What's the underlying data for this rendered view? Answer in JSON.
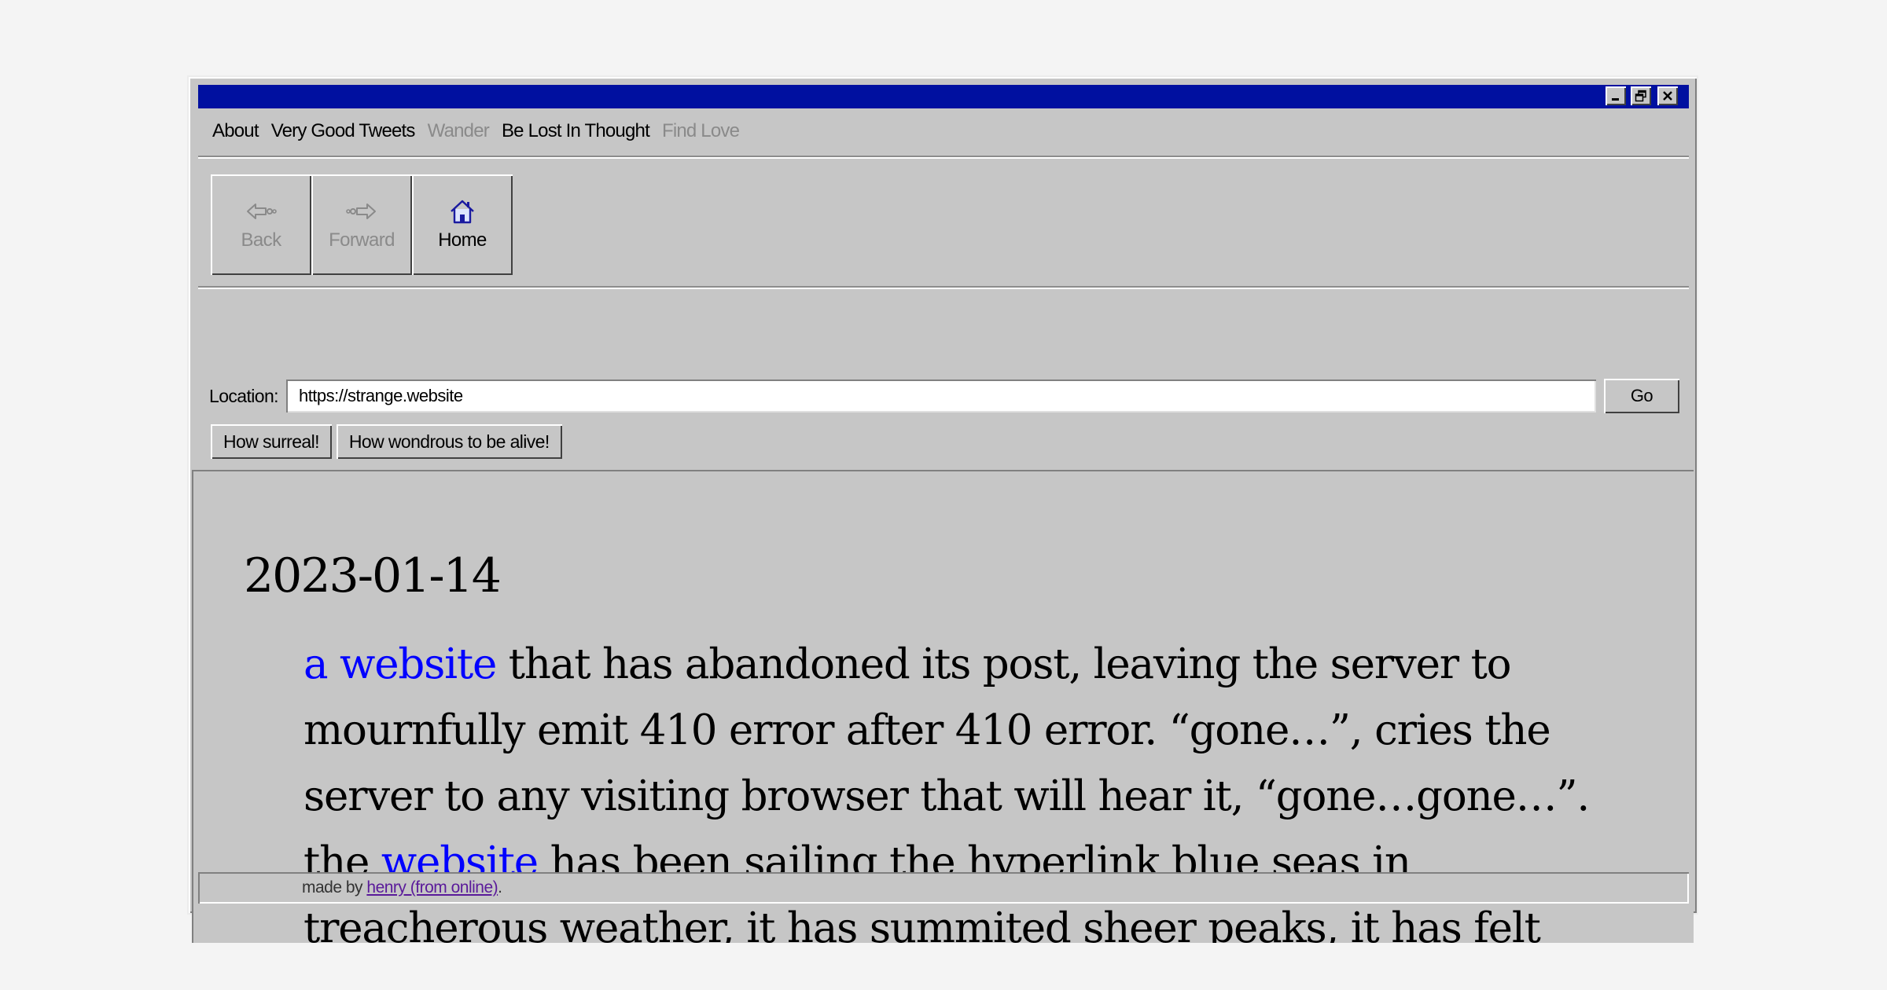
{
  "menubar": {
    "items": [
      {
        "label": "About",
        "disabled": false
      },
      {
        "label": "Very Good Tweets",
        "disabled": false
      },
      {
        "label": "Wander",
        "disabled": true
      },
      {
        "label": "Be Lost In Thought",
        "disabled": false
      },
      {
        "label": "Find Love",
        "disabled": true
      }
    ]
  },
  "window_controls": {
    "minimize_icon": "minimize-icon",
    "restore_icon": "restore-icon",
    "close_icon": "close-icon"
  },
  "toolbar": {
    "back_label": "Back",
    "forward_label": "Forward",
    "home_label": "Home",
    "back_icon": "back-arrow-icon",
    "forward_icon": "forward-arrow-icon",
    "home_icon": "home-icon"
  },
  "location": {
    "label": "Location:",
    "value": "https://strange.website",
    "go_label": "Go"
  },
  "bookmarks": [
    {
      "label": "How surreal!"
    },
    {
      "label": "How wondrous to be alive!"
    }
  ],
  "post": {
    "date": "2023-01-14",
    "segments": [
      {
        "text": "a website",
        "link": true
      },
      {
        "text": " that has abandoned its post, leaving the server to mournfully emit 410 error after 410 error. “gone…”, cries the server to any visiting browser that will hear it, “gone…gone…”. the ",
        "link": false
      },
      {
        "text": "website",
        "link": true
      },
      {
        "text": " has been sailing the hyperlink blue seas in treacherous weather, it has summited sheer peaks, it has felt",
        "link": false
      }
    ]
  },
  "statusbar": {
    "prefix": "made by ",
    "link_text": "henry (from online)",
    "suffix": "."
  },
  "colors": {
    "titlebar": "#0010a0",
    "chrome": "#c6c6c6",
    "link": "#0000ff",
    "visited_link": "#5a1a9a",
    "disabled_text": "#8a8a8a"
  }
}
